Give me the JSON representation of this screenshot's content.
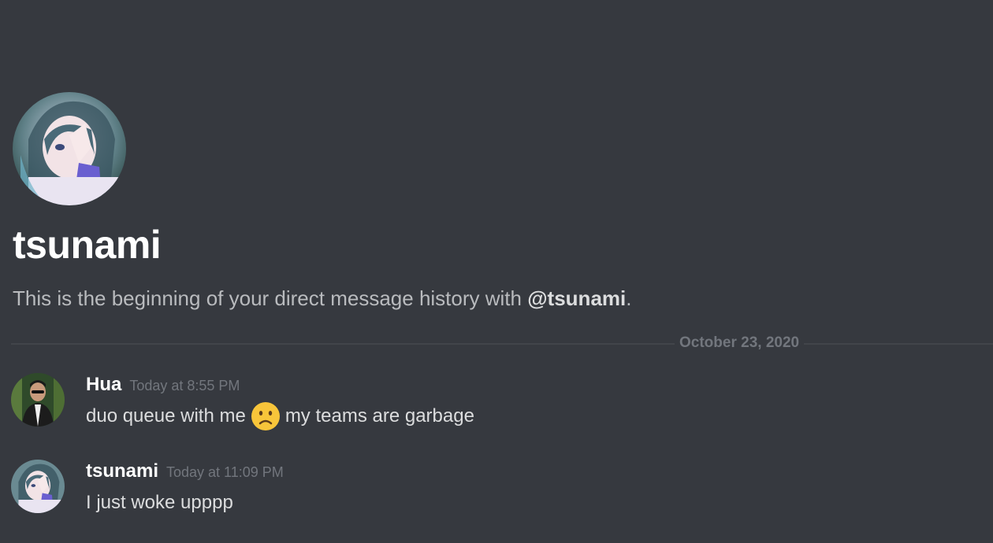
{
  "header": {
    "avatar_icon": "tsunami-avatar",
    "title": "tsunami",
    "intro_text": "This is the beginning of your direct message history with ",
    "intro_mention": "@tsunami",
    "intro_suffix": "."
  },
  "divider": {
    "date_label": "October 23, 2020"
  },
  "messages": [
    {
      "username": "Hua",
      "timestamp": "Today at 8:55 PM",
      "avatar_icon": "hua-avatar",
      "content_before_emoji": "duo queue with me",
      "emoji": "frowning-face-emoji",
      "content_after_emoji": "my teams are garbage"
    },
    {
      "username": "tsunami",
      "timestamp": "Today at 11:09 PM",
      "avatar_icon": "tsunami-avatar",
      "content": "I just woke upppp"
    }
  ],
  "colors": {
    "background": "#36393f",
    "title": "#ffffff",
    "text": "#dcddde",
    "muted": "#72767d",
    "divider": "#42454a",
    "emoji": "#f8c53a"
  }
}
